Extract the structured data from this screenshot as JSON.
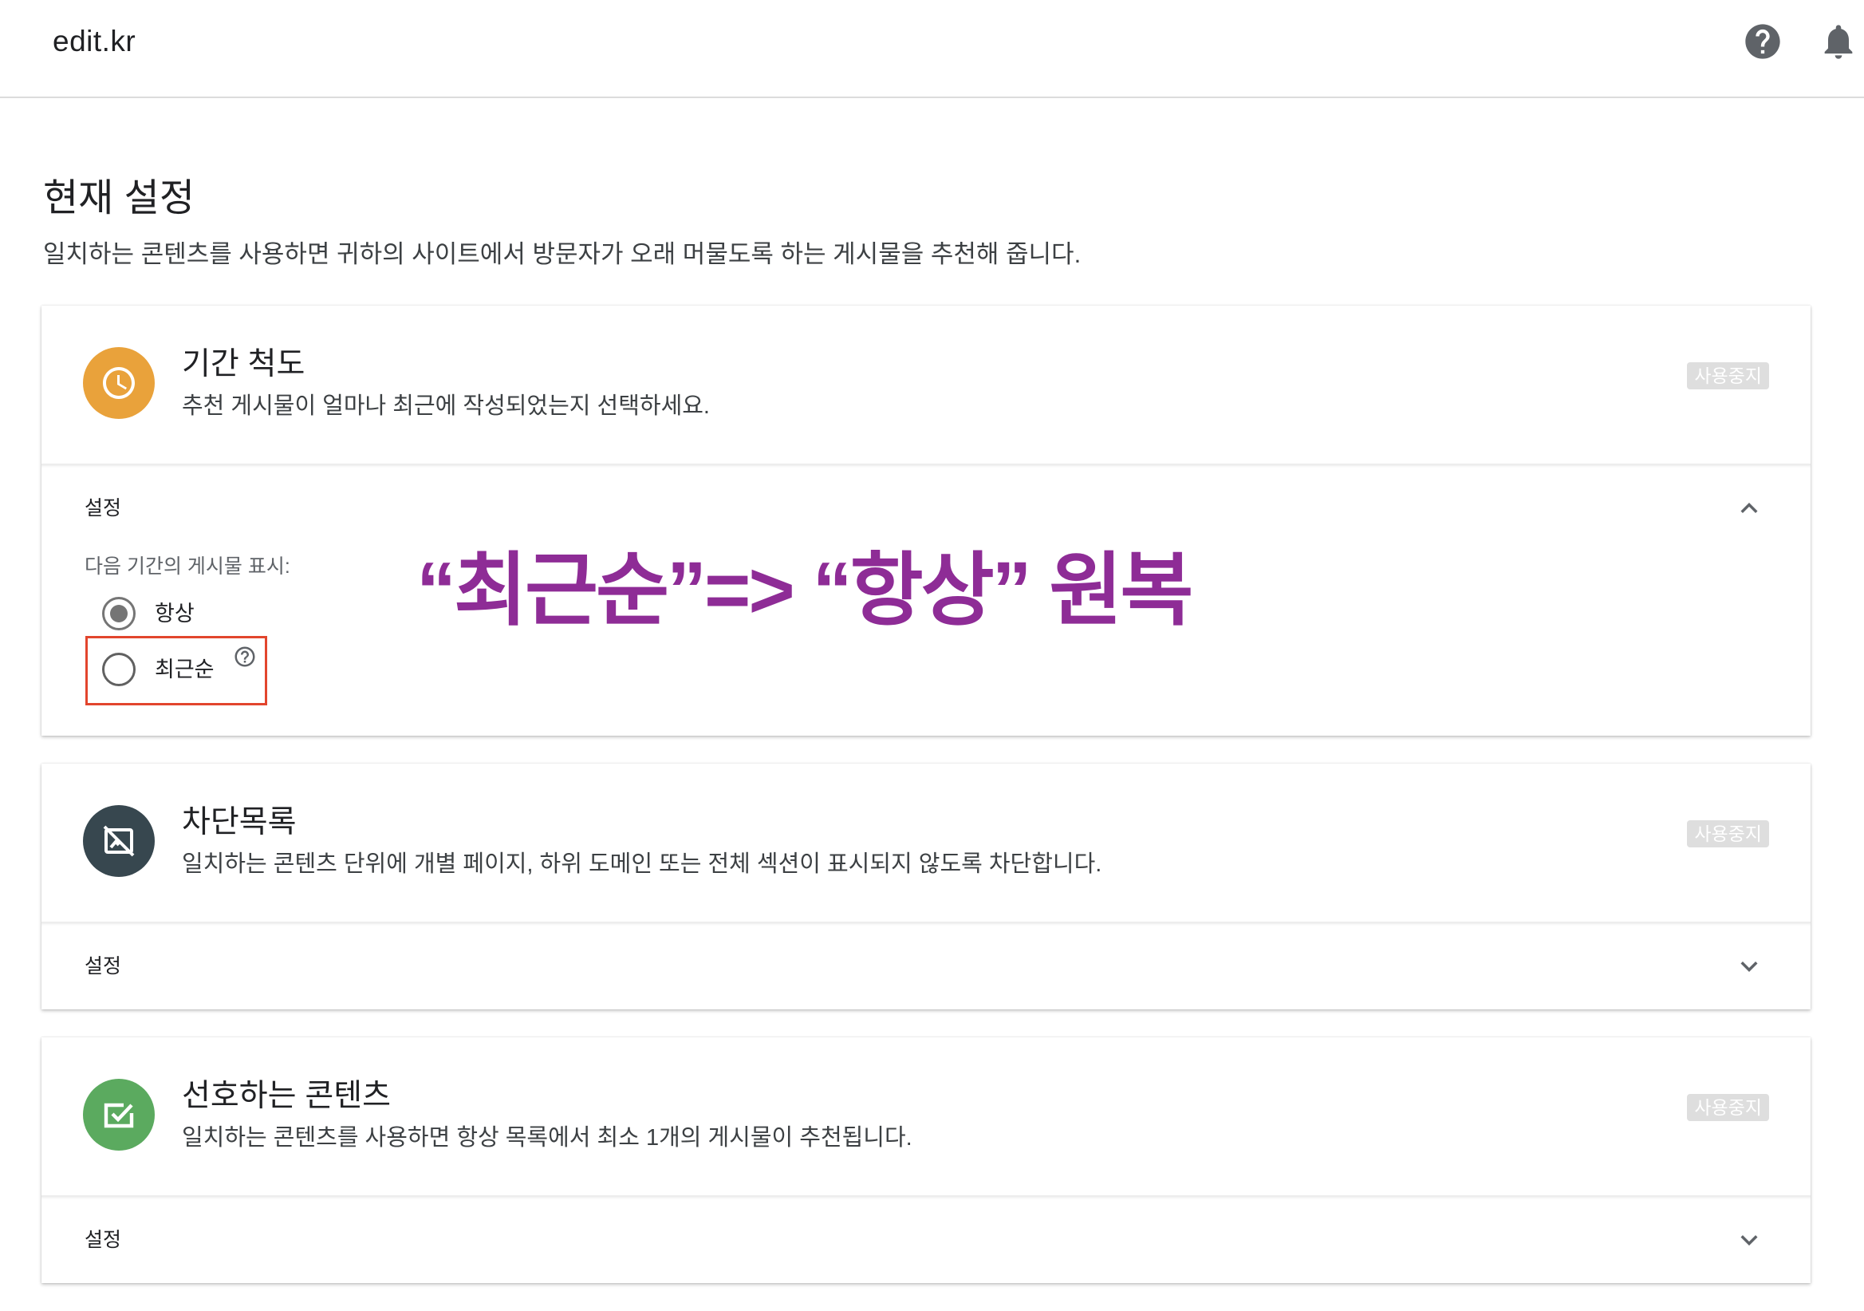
{
  "app": {
    "title": "edit.kr"
  },
  "header": {
    "icons": {
      "help": "help-icon",
      "notifications": "bell-icon"
    }
  },
  "page": {
    "title": "현재 설정",
    "description": "일치하는 콘텐츠를 사용하면 귀하의 사이트에서 방문자가 오래 머물도록 하는 게시물을 추천해 줍니다."
  },
  "cards": [
    {
      "title": "기간 척도",
      "description": "추천 게시물이 얼마나 최근에 작성되었는지 선택하세요.",
      "badge": "사용중지",
      "icon": "clock-icon",
      "icon_color": "#E9A23B",
      "settings_label": "설정",
      "expanded": true,
      "settings": {
        "prompt": "다음 기간의 게시물 표시:",
        "options": [
          {
            "label": "항상",
            "selected": true
          },
          {
            "label": "최근순",
            "selected": false,
            "help_icon": "help-outline-icon"
          }
        ]
      }
    },
    {
      "title": "차단목록",
      "description": "일치하는 콘텐츠 단위에 개별 페이지, 하위 도메인 또는 전체 섹션이 표시되지 않도록 차단합니다.",
      "badge": "사용중지",
      "icon": "block-icon",
      "icon_color": "#37474F",
      "settings_label": "설정",
      "expanded": false
    },
    {
      "title": "선호하는 콘텐츠",
      "description": "일치하는 콘텐츠를 사용하면 항상 목록에서 최소 1개의 게시물이 추천됩니다.",
      "badge": "사용중지",
      "icon": "checkbox-icon",
      "icon_color": "#5BAA5F",
      "settings_label": "설정",
      "expanded": false
    }
  ],
  "annotation": {
    "text": "“최근순”=> “항상” 원복",
    "color": "#8E2C96",
    "highlight_color": "#E2452D"
  }
}
